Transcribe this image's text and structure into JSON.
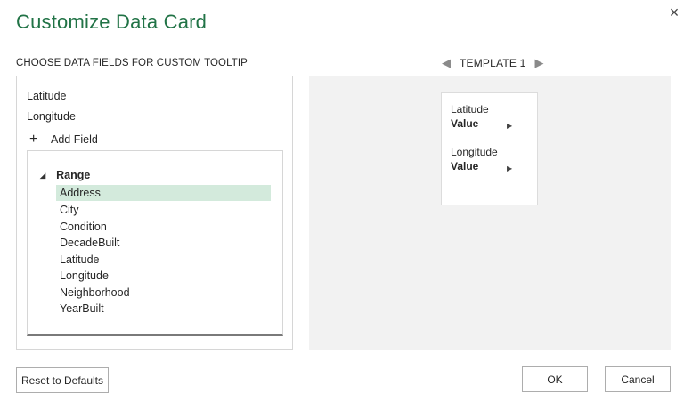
{
  "dialog": {
    "title": "Customize Data Card",
    "close_glyph": "×"
  },
  "fields_section": {
    "heading": "CHOOSE DATA FIELDS FOR CUSTOM TOOLTIP",
    "selected_fields": [
      "Latitude",
      "Longitude"
    ],
    "add_field_label": "Add Field",
    "add_icon": "+"
  },
  "tree": {
    "root_label": "Range",
    "items": [
      "Address",
      "City",
      "Condition",
      "DecadeBuilt",
      "Latitude",
      "Longitude",
      "Neighborhood",
      "YearBuilt"
    ],
    "selected_item": "Address"
  },
  "template_nav": {
    "label": "TEMPLATE 1",
    "prev_icon": "◀",
    "next_icon": "▶"
  },
  "card": {
    "fields": [
      {
        "name": "Latitude",
        "value": "Value"
      },
      {
        "name": "Longitude",
        "value": "Value"
      }
    ],
    "arrow_icon": "▶"
  },
  "buttons": {
    "reset": "Reset to Defaults",
    "ok": "OK",
    "cancel": "Cancel"
  },
  "colors": {
    "title": "#217346",
    "selection": "#d3eadc",
    "preview_bg": "#f2f2f2"
  }
}
